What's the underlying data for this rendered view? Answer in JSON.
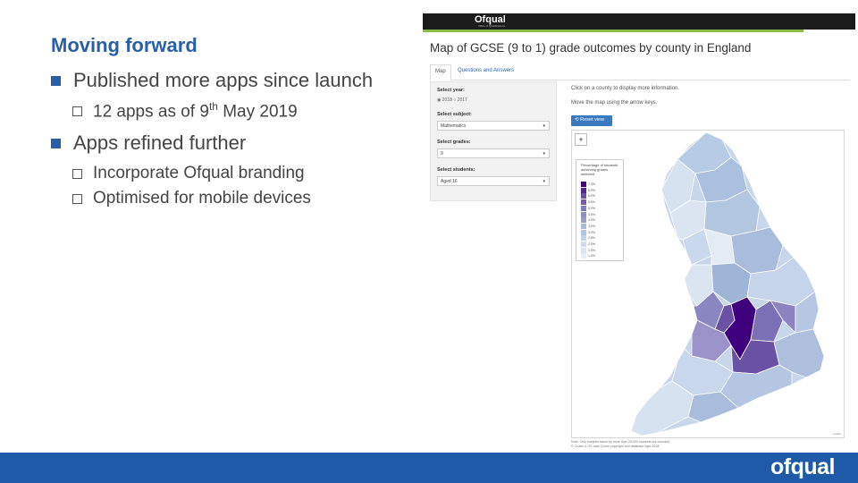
{
  "slide": {
    "title": "Moving forward",
    "bullets": [
      {
        "text": "Published more apps since launch",
        "sub": [
          {
            "pre": "12 apps as of 9",
            "sup": "th",
            "post": " May 2019"
          }
        ]
      },
      {
        "text": "Apps refined further",
        "sub": [
          {
            "text": "Incorporate Ofqual branding"
          },
          {
            "text": "Optimised for mobile devices"
          }
        ]
      }
    ]
  },
  "app": {
    "logo": "Ofqual",
    "logo_sub": "Office of Qualifications",
    "title": "Map of GCSE (9 to 1) grade outcomes by county in England",
    "tabs": [
      "Map",
      "Questions and Answers"
    ],
    "panel": {
      "year_label": "Select year:",
      "year_options": [
        "2018",
        "2017"
      ],
      "subject_label": "Select subject:",
      "subject_value": "Mathematics",
      "grades_label": "Select grades:",
      "grades_value": "9",
      "students_label": "Select students:",
      "students_value": "Aged 16"
    },
    "info_click": "Click on a county to display more information.",
    "info_move": "Move the map using the arrow keys.",
    "reset_label": "Reset view",
    "zoom_plus": "+",
    "legend": {
      "title": "Percentage of students achieving grades selected",
      "items": [
        {
          "label": "7.0%",
          "color": "#3f007d"
        },
        {
          "label": "6.5%",
          "color": "#54278f"
        },
        {
          "label": "6.0%",
          "color": "#6a51a3"
        },
        {
          "label": "5.5%",
          "color": "#7b5ba8"
        },
        {
          "label": "5.0%",
          "color": "#807dba"
        },
        {
          "label": "4.5%",
          "color": "#8f8fc4"
        },
        {
          "label": "4.0%",
          "color": "#9e9ac8"
        },
        {
          "label": "3.5%",
          "color": "#a9b7d8"
        },
        {
          "label": "3.0%",
          "color": "#b3c6e0"
        },
        {
          "label": "2.5%",
          "color": "#c1d3e8"
        },
        {
          "label": "2.0%",
          "color": "#cfdcee"
        },
        {
          "label": "1.5%",
          "color": "#dbe5f2"
        },
        {
          "label": "1.0%",
          "color": "#e6edf6"
        }
      ]
    },
    "attribution": "Leaflet",
    "note1": "Note: Only subjects taken by more than 25,000 students are included",
    "note2": "© Crown & OS data Crown copyright and database right 2018"
  },
  "footer": {
    "logo": "ofqual",
    "bg": "#1e5aa8"
  }
}
